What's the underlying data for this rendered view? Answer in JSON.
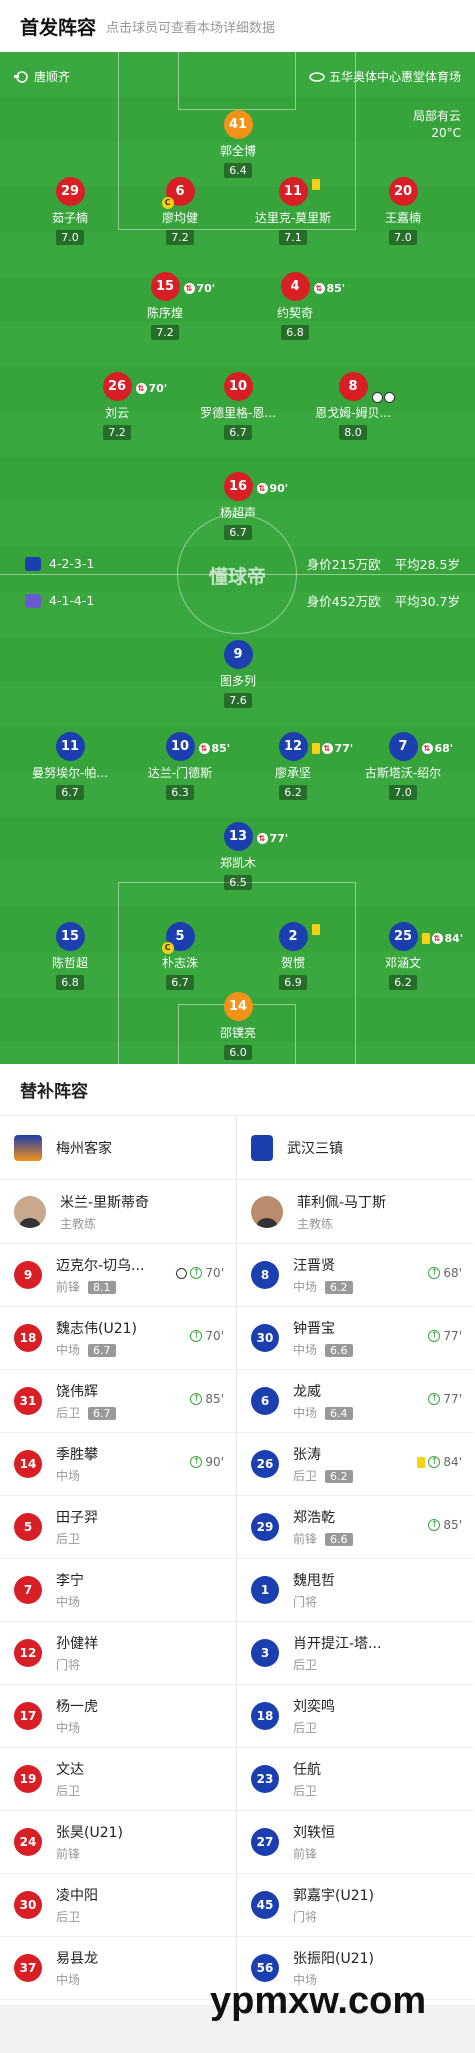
{
  "header": {
    "title": "首发阵容",
    "subtitle": "点击球员可查看本场详细数据"
  },
  "pitch": {
    "referee": "唐顺齐",
    "stadium": "五华奥体中心惠堂体育场",
    "weather": "局部有云",
    "temp": "20°C",
    "brand": "懂球帝"
  },
  "home_info": {
    "formation": "4-2-3-1",
    "value": "身价215万欧",
    "age": "平均28.5岁"
  },
  "away_info": {
    "formation": "4-1-4-1",
    "value": "身价452万欧",
    "age": "平均30.7岁"
  },
  "home_players": [
    {
      "num": "41",
      "name": "郭全博",
      "rating": "6.4",
      "team": "org"
    },
    {
      "num": "29",
      "name": "茹子楠",
      "rating": "7.0",
      "team": "red"
    },
    {
      "num": "6",
      "name": "廖均健",
      "rating": "7.2",
      "team": "red",
      "captain": "C"
    },
    {
      "num": "11",
      "name": "达里克-莫里斯",
      "rating": "7.1",
      "team": "red",
      "card": true
    },
    {
      "num": "20",
      "name": "王嘉楠",
      "rating": "7.0",
      "team": "red"
    },
    {
      "num": "15",
      "name": "陈序煌",
      "rating": "7.2",
      "team": "red",
      "sub": "70'"
    },
    {
      "num": "4",
      "name": "约契奇",
      "rating": "6.8",
      "team": "red",
      "sub": "85'"
    },
    {
      "num": "26",
      "name": "刘云",
      "rating": "7.2",
      "team": "red",
      "sub": "70'"
    },
    {
      "num": "10",
      "name": "罗德里格-恩...",
      "rating": "6.7",
      "team": "red"
    },
    {
      "num": "8",
      "name": "恩戈姆-姆贝...",
      "rating": "8.0",
      "team": "red",
      "goals": 2
    },
    {
      "num": "16",
      "name": "杨超声",
      "rating": "6.7",
      "team": "red",
      "sub": "90'"
    }
  ],
  "away_players": [
    {
      "num": "9",
      "name": "图多列",
      "rating": "7.6",
      "team": "blue"
    },
    {
      "num": "11",
      "name": "曼努埃尔-帕...",
      "rating": "6.7",
      "team": "blue"
    },
    {
      "num": "10",
      "name": "达兰-门德斯",
      "rating": "6.3",
      "team": "blue",
      "sub": "85'"
    },
    {
      "num": "12",
      "name": "廖承坚",
      "rating": "6.2",
      "team": "blue",
      "sub": "77'",
      "card": true
    },
    {
      "num": "7",
      "name": "古斯塔沃-绍尔",
      "rating": "7.0",
      "team": "blue",
      "sub": "68'"
    },
    {
      "num": "13",
      "name": "郑凯木",
      "rating": "6.5",
      "team": "blue",
      "sub": "77'"
    },
    {
      "num": "15",
      "name": "陈哲超",
      "rating": "6.8",
      "team": "blue"
    },
    {
      "num": "5",
      "name": "朴志洙",
      "rating": "6.7",
      "team": "blue",
      "captain": "C"
    },
    {
      "num": "2",
      "name": "贺惯",
      "rating": "6.9",
      "team": "blue",
      "card": true
    },
    {
      "num": "25",
      "name": "邓涵文",
      "rating": "6.2",
      "team": "blue",
      "sub": "84'",
      "card": true
    },
    {
      "num": "14",
      "name": "邵镤亮",
      "rating": "6.0",
      "team": "org"
    }
  ],
  "subs": {
    "title": "替补阵容",
    "home_team": "梅州客家",
    "away_team": "武汉三镇",
    "home_coach": {
      "name": "米兰-里斯蒂奇",
      "role": "主教练"
    },
    "away_coach": {
      "name": "菲利佩-马丁斯",
      "role": "主教练"
    },
    "home_list": [
      {
        "num": "9",
        "name": "迈克尔-切乌...",
        "pos": "前锋",
        "rating": "8.1",
        "evt": "70'",
        "goal": true
      },
      {
        "num": "18",
        "name": "魏志伟(U21)",
        "pos": "中场",
        "rating": "6.7",
        "evt": "70'"
      },
      {
        "num": "31",
        "name": "饶伟辉",
        "pos": "后卫",
        "rating": "6.7",
        "evt": "85'"
      },
      {
        "num": "14",
        "name": "季胜攀",
        "pos": "中场",
        "rating": "",
        "evt": "90'"
      },
      {
        "num": "5",
        "name": "田子羿",
        "pos": "后卫",
        "rating": "",
        "evt": ""
      },
      {
        "num": "7",
        "name": "李宁",
        "pos": "中场",
        "rating": "",
        "evt": ""
      },
      {
        "num": "12",
        "name": "孙健祥",
        "pos": "门将",
        "rating": "",
        "evt": ""
      },
      {
        "num": "17",
        "name": "杨一虎",
        "pos": "中场",
        "rating": "",
        "evt": ""
      },
      {
        "num": "19",
        "name": "文达",
        "pos": "后卫",
        "rating": "",
        "evt": ""
      },
      {
        "num": "24",
        "name": "张昊(U21)",
        "pos": "前锋",
        "rating": "",
        "evt": ""
      },
      {
        "num": "30",
        "name": "凌中阳",
        "pos": "后卫",
        "rating": "",
        "evt": ""
      },
      {
        "num": "37",
        "name": "易县龙",
        "pos": "中场",
        "rating": "",
        "evt": ""
      }
    ],
    "away_list": [
      {
        "num": "8",
        "name": "汪晋贤",
        "pos": "中场",
        "rating": "6.2",
        "evt": "68'"
      },
      {
        "num": "30",
        "name": "钟晋宝",
        "pos": "中场",
        "rating": "6.6",
        "evt": "77'"
      },
      {
        "num": "6",
        "name": "龙威",
        "pos": "中场",
        "rating": "6.4",
        "evt": "77'"
      },
      {
        "num": "26",
        "name": "张涛",
        "pos": "后卫",
        "rating": "6.2",
        "evt": "84'",
        "card": true
      },
      {
        "num": "29",
        "name": "郑浩乾",
        "pos": "前锋",
        "rating": "6.6",
        "evt": "85'"
      },
      {
        "num": "1",
        "name": "魏甩哲",
        "pos": "门将",
        "rating": "",
        "evt": ""
      },
      {
        "num": "3",
        "name": "肖开提江-塔...",
        "pos": "后卫",
        "rating": "",
        "evt": ""
      },
      {
        "num": "18",
        "name": "刘奕鸣",
        "pos": "后卫",
        "rating": "",
        "evt": ""
      },
      {
        "num": "23",
        "name": "任航",
        "pos": "后卫",
        "rating": "",
        "evt": ""
      },
      {
        "num": "27",
        "name": "刘轶恒",
        "pos": "前锋",
        "rating": "",
        "evt": ""
      },
      {
        "num": "45",
        "name": "郭嘉宇(U21)",
        "pos": "门将",
        "rating": "",
        "evt": ""
      },
      {
        "num": "56",
        "name": "张振阳(U21)",
        "pos": "中场",
        "rating": "",
        "evt": ""
      }
    ]
  },
  "watermark": "ypmxw.com",
  "colors": {
    "home": "#d81f26",
    "away": "#1b3fae",
    "gk": "#f39219",
    "pitch": "#37a33b"
  }
}
